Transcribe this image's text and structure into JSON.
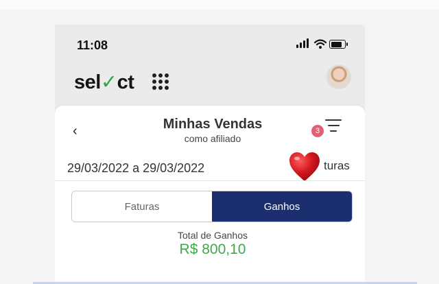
{
  "status_bar": {
    "time": "11:08"
  },
  "header": {
    "logo": {
      "part1": "sel",
      "check": "✓",
      "part2": "ct"
    }
  },
  "sheet": {
    "title": "Minhas Vendas",
    "subtitle": "como afiliado",
    "back_glyph": "‹",
    "filter_badge": "3",
    "date_range": "29/03/2022 a 29/03/2022",
    "faturas_link": "turas"
  },
  "tabs": [
    {
      "label": "Faturas",
      "active": false
    },
    {
      "label": "Ganhos",
      "active": true
    }
  ],
  "totals": {
    "label": "Total de Ganhos",
    "value": "R$  800,10"
  },
  "colors": {
    "accent_navy": "#1b2f6f",
    "money_green": "#3fa84a",
    "badge_pink": "#e0607a",
    "heart_red": "#d0161e"
  },
  "icons": [
    "back-chevron-icon",
    "apps-grid-icon",
    "filter-icon",
    "heart-icon",
    "wifi-icon",
    "battery-icon",
    "cellular-signal-icon"
  ]
}
